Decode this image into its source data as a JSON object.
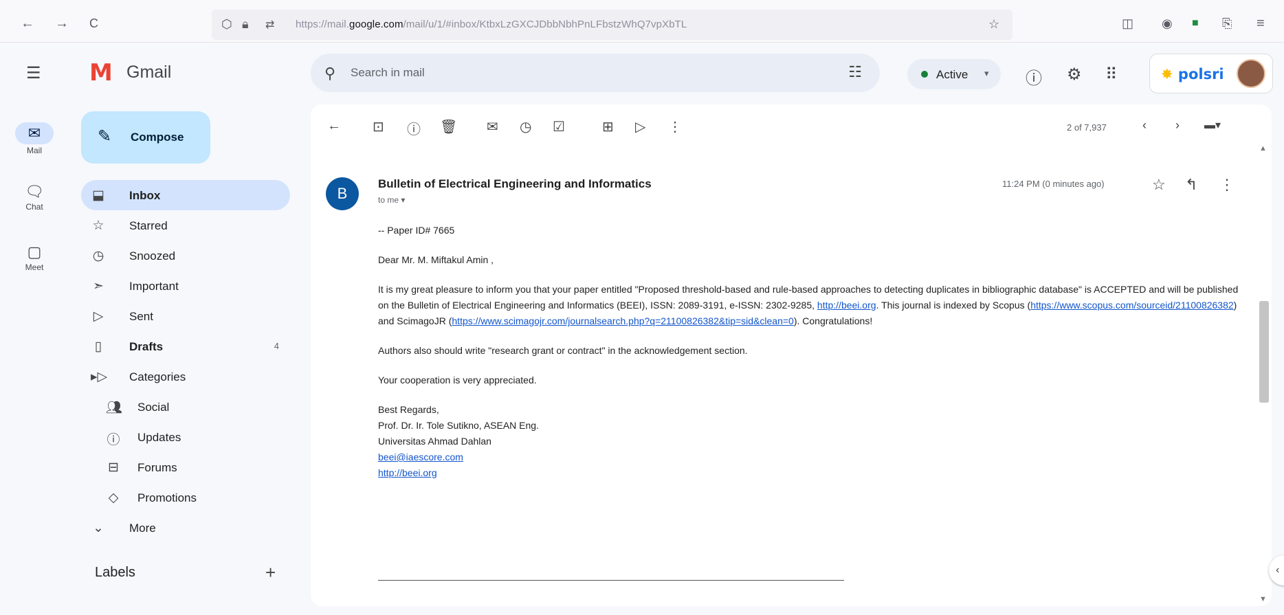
{
  "browser": {
    "back": "←",
    "forward": "→",
    "reload": "C",
    "url_prefix": "https://mail.",
    "url_domain": "google.com",
    "url_path": "/mail/u/1/#inbox/KtbxLzGXCJDbbNbhPnLFbstzWhQ7vpXbTL",
    "icons": [
      "shield-icon",
      "lock-icon",
      "tune-icon",
      "star-icon",
      "pocket-icon",
      "account-icon",
      "extension-icon",
      "library-icon",
      "menu-icon"
    ]
  },
  "rail": {
    "items": [
      {
        "label": "Mail",
        "icon": "mail-icon"
      },
      {
        "label": "Chat",
        "icon": "chat-icon"
      },
      {
        "label": "Meet",
        "icon": "meet-icon"
      }
    ]
  },
  "app": {
    "name": "Gmail",
    "compose": "Compose"
  },
  "nav": {
    "items": [
      {
        "label": "Inbox",
        "icon": "inbox-icon",
        "count": ""
      },
      {
        "label": "Starred",
        "icon": "star-icon",
        "count": ""
      },
      {
        "label": "Snoozed",
        "icon": "clock-icon",
        "count": ""
      },
      {
        "label": "Important",
        "icon": "important-icon",
        "count": ""
      },
      {
        "label": "Sent",
        "icon": "send-icon",
        "count": ""
      },
      {
        "label": "Drafts",
        "icon": "draft-icon",
        "count": "4"
      },
      {
        "label": "Categories",
        "icon": "label-icon",
        "count": ""
      },
      {
        "label": "Social",
        "icon": "people-icon",
        "count": ""
      },
      {
        "label": "Updates",
        "icon": "info-icon",
        "count": ""
      },
      {
        "label": "Forums",
        "icon": "forum-icon",
        "count": ""
      },
      {
        "label": "Promotions",
        "icon": "tag-icon",
        "count": ""
      },
      {
        "label": "More",
        "icon": "chevron-down-icon",
        "count": ""
      }
    ],
    "labels_header": "Labels",
    "labels_add": "+"
  },
  "search": {
    "placeholder": "Search in mail"
  },
  "status": {
    "label": "Active",
    "color": "#188038"
  },
  "account": {
    "org_logo": "polsri"
  },
  "toolbar": {
    "count": "2 of 7,937"
  },
  "message": {
    "avatar_letter": "B",
    "avatar_color": "#0b57a0",
    "sender": "Bulletin of Electrical Engineering and Informatics",
    "to": "to me",
    "time": "11:24 PM (0 minutes ago)",
    "paper_id": "-- Paper ID# 7665",
    "greeting": "Dear Mr. M. Miftakul Amin ,",
    "para1_a": "It is my great pleasure to inform you that your paper entitled \"Proposed threshold-based and rule-based approaches to detecting duplicates in bibliographic database\" is ACCEPTED and will be published on the Bulletin of Electrical Engineering and Informatics (BEEI), ISSN: 2089-3191, e-ISSN: 2302-9285, ",
    "link_beei": "http://beei.org",
    "para1_b": ". This journal is indexed by Scopus (",
    "link_scopus": "https://www.scopus.com/sourceid/21100826382",
    "para1_c": ") and ScimagoJR (",
    "link_scimago": "https://www.scimagojr.com/journalsearch.php?q=21100826382&tip=sid&clean=0",
    "para1_d": "). Congratulations!",
    "para2": "Authors also should write \"research grant or contract\" in the acknowledgement section.",
    "para3": "Your cooperation is very appreciated.",
    "sig_regards": "Best Regards,",
    "sig_name": "Prof. Dr. Ir. Tole Sutikno, ASEAN Eng.",
    "sig_univ": "Universitas Ahmad Dahlan",
    "sig_email": "beei@iaescore.com",
    "sig_url": "http://beei.org"
  }
}
